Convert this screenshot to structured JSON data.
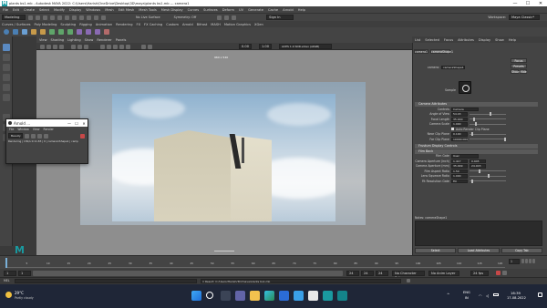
{
  "window": {
    "title": "plants bs1.mb - Autodesk MAYA 2022: C:\\Users\\Harish\\OneDrive\\Desktop\\3D\\maya\\plants bs1.mb  ---  camera1",
    "minimize": "—",
    "maximize": "☐",
    "close": "✕"
  },
  "menubar": [
    "File",
    "Edit",
    "Create",
    "Select",
    "Modify",
    "Display",
    "Windows",
    "Mesh",
    "Edit Mesh",
    "Mesh Tools",
    "Mesh Display",
    "Curves",
    "Surfaces",
    "Deform",
    "UV",
    "Generate",
    "Cache",
    "Arnold",
    "Help"
  ],
  "statusline": {
    "menuset": "Modeling",
    "no_live": "No Live Surface",
    "symmetry": "Symmetry: Off",
    "sign_in": "Sign In",
    "workspace_label": "Workspace:",
    "workspace": "Maya Classic*"
  },
  "shelf_tabs": [
    "Curves / Surfaces",
    "Poly Modeling",
    "Sculpting",
    "Rigging",
    "Animation",
    "Rendering",
    "FX",
    "FX Caching",
    "Custom",
    "Arnold",
    "Bifrost",
    "MASH",
    "Motion Graphics",
    "XGen"
  ],
  "panel_menu": [
    "View",
    "Shading",
    "Lighting",
    "Show",
    "Renderer",
    "Panels"
  ],
  "panel_toolbar": {
    "value_a": "0.00",
    "value_b": "1.00",
    "colorspace": "ACES 1.0 SDR-video (sRGB)"
  },
  "viewport": {
    "resolution_gate": "960 x 540"
  },
  "attr_editor": {
    "tabs": [
      "List",
      "Selected",
      "Focus",
      "Attributes",
      "Display",
      "Show",
      "Help"
    ],
    "node_tabs": [
      "camera1",
      "cameraShape1"
    ],
    "node_label": "camera:",
    "node_value": "cameraShape1",
    "focus_btn": "Focus",
    "presets_btn": "Presets",
    "show_btn": "Show",
    "hide_btn": "Hide",
    "sample_label": "Sample",
    "sections": {
      "camera_attributes": "Camera Attributes",
      "frustum": "Frustum Display Controls",
      "film_back": "Film Back"
    },
    "controls_label": "Controls",
    "controls_value": "Camera",
    "camera_rows": [
      {
        "label": "Angle of View",
        "value": "54.43"
      },
      {
        "label": "Focal Length",
        "value": "35.000"
      },
      {
        "label": "Camera Scale",
        "value": "1.000"
      }
    ],
    "auto_render_clip": "Auto Render Clip Plane",
    "clip_rows": [
      {
        "label": "Near Clip Plane",
        "value": "0.100"
      },
      {
        "label": "Far Clip Plane",
        "value": "10000.000"
      }
    ],
    "film_gate_label": "Film Gate",
    "film_gate_value": "User",
    "aperture_inch": {
      "label": "Camera Aperture (inch)",
      "a": "1.417",
      "b": "0.945"
    },
    "aperture_mm": {
      "label": "Camera Aperture (mm)",
      "a": "35.999",
      "b": "24.003"
    },
    "film_rows": [
      {
        "label": "Film Aspect Ratio",
        "value": "1.50"
      },
      {
        "label": "Lens Squeeze Ratio",
        "value": "1.000"
      },
      {
        "label": "Fit Resolution Gate",
        "value": "Fill"
      }
    ],
    "notes_label": "Notes: cameraShape1",
    "bottom_buttons": [
      "Select",
      "Load Attributes",
      "Copy Tab"
    ]
  },
  "arnold_window": {
    "title": "Arnold ...",
    "menu": [
      "File",
      "Window",
      "View",
      "Render"
    ],
    "dropdown": "Beauty",
    "status": "Rendering | 130/s 0:11.83 | 0 | camera1Shape1 | camp"
  },
  "timeline": {
    "ticks": [
      "1",
      "5",
      "10",
      "15",
      "20",
      "25",
      "30",
      "35",
      "40",
      "45",
      "50",
      "55",
      "60",
      "65",
      "70",
      "75",
      "80",
      "85",
      "90",
      "95",
      "100",
      "105",
      "110",
      "115",
      "120"
    ],
    "current": "1"
  },
  "range": {
    "start": "1",
    "start2": "1",
    "end": "24",
    "end2": "24",
    "end3": "24",
    "character_set": "No Character Set",
    "anim_layer": "No Anim Layer",
    "fps": "24 fps"
  },
  "cmdline": {
    "label": "MEL",
    "result": "// Result: C:/Users/Harish/3D/maya/plants bs1.mb"
  },
  "taskbar": {
    "temp": "29°C",
    "weather": "Partly cloudy",
    "lang1": "ENG",
    "lang2": "IN",
    "time": "16:39",
    "date": "17-08-2022"
  },
  "colors": {
    "taskbar": "#1f2637",
    "maya_teal": "#1a9aa0",
    "attr_header": "#5a5a5a"
  }
}
